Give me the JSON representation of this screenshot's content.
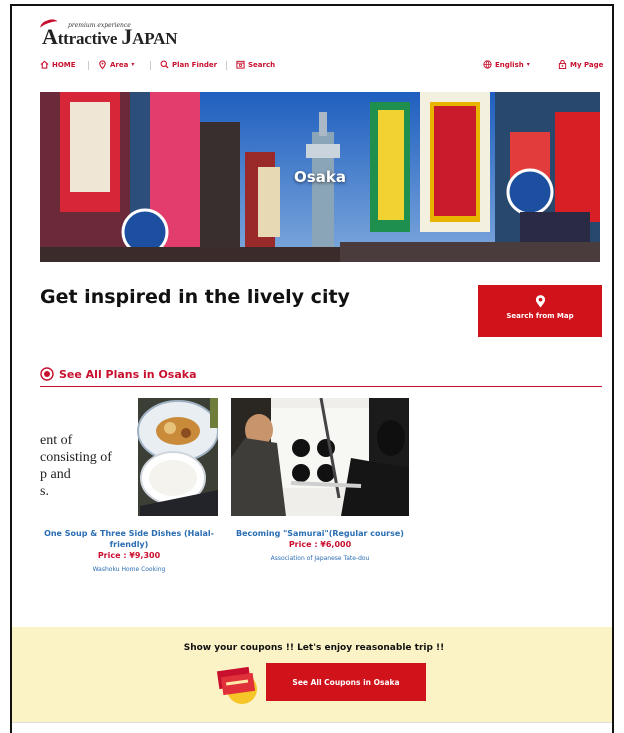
{
  "logo": {
    "tagline": "premium experience",
    "name_part1": "ttractive",
    "name_part2": "APAN",
    "initial1": "A",
    "initial2": "J"
  },
  "nav": {
    "home": "HOME",
    "area": "Area",
    "plan_finder": "Plan Finder",
    "search": "Search",
    "language": "English",
    "my_page": "My Page"
  },
  "hero": {
    "title": "Osaka"
  },
  "main": {
    "headline": "Get inspired in the lively city",
    "map_button": "Search from Map",
    "see_all_plans": "See All Plans in Osaka"
  },
  "cards": [
    {
      "image_text": [
        "ent of",
        "consisting of",
        "p and",
        "s."
      ],
      "title": "One Soup & Three Side Dishes (Halal-friendly)",
      "price": "Price : ¥9,300",
      "provider": "Washoku Home Cooking"
    },
    {
      "title": "Becoming \"Samurai\"(Regular course)",
      "price": "Price : ¥6,000",
      "provider": "Association of Japanese Tate-dou"
    }
  ],
  "coupon": {
    "text": "Show your coupons !! Let's enjoy reasonable trip !!",
    "button": "See All Coupons in Osaka"
  },
  "colors": {
    "accent": "#c8102e",
    "button_red": "#d0121b",
    "link_blue": "#2a6db2",
    "coupon_band": "#fbf3c6"
  }
}
